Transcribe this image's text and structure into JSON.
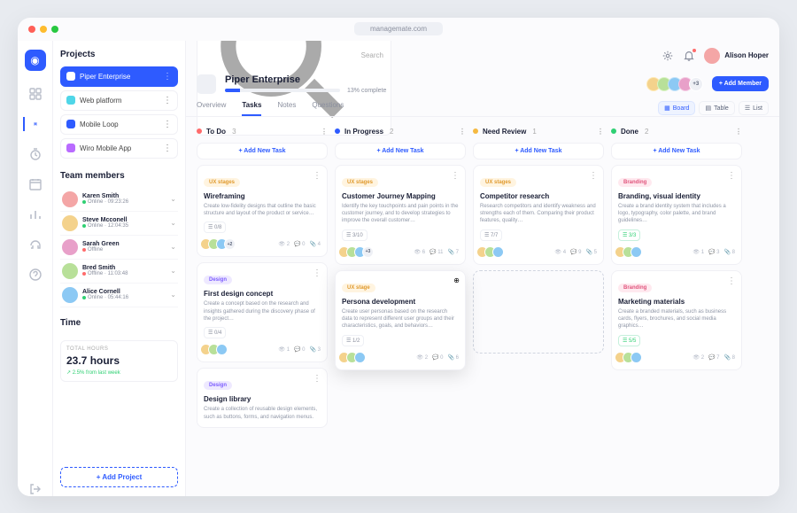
{
  "url": "managemate.com",
  "user": {
    "name": "Alison Hoper"
  },
  "search_placeholder": "Search",
  "sidebar": {
    "projects_title": "Projects",
    "projects": [
      {
        "name": "Piper Enterprise",
        "color": "#fff",
        "active": true
      },
      {
        "name": "Web platform",
        "color": "#4fd6e8"
      },
      {
        "name": "Mobile Loop",
        "color": "#2e5bff"
      },
      {
        "name": "Wiro Mobile App",
        "color": "#b96bff"
      }
    ],
    "members_title": "Team members",
    "members": [
      {
        "name": "Karen Smith",
        "status": "Online",
        "time": "09:23:26",
        "online": true,
        "color": "#f4a6a6"
      },
      {
        "name": "Steve Mcconell",
        "status": "Online",
        "time": "12:04:35",
        "online": true,
        "color": "#f4d28c"
      },
      {
        "name": "Sarah Green",
        "status": "Offline",
        "online": false,
        "color": "#e8a0c9"
      },
      {
        "name": "Bred Smith",
        "status": "Offline",
        "time": "11:03:48",
        "online": false,
        "color": "#b8e099"
      },
      {
        "name": "Alice Cornell",
        "status": "Online",
        "time": "05:44:16",
        "online": true,
        "color": "#8cc9f4"
      }
    ],
    "time_title": "Time",
    "time_label": "TOTAL HOURS",
    "time_value": "23.7 hours",
    "time_delta": "2.5% from last week",
    "add_project": "+ Add Project"
  },
  "project": {
    "title": "Piper Enterprise",
    "progress_pct": 13,
    "progress_text": "13% complete",
    "extra_members": "+3",
    "add_member": "+ Add Member"
  },
  "tabs": [
    "Overview",
    "Tasks",
    "Notes",
    "Questions"
  ],
  "active_tab": "Tasks",
  "views": {
    "board": "Board",
    "table": "Table",
    "list": "List"
  },
  "add_task": "+ Add New Task",
  "columns": [
    {
      "name": "To Do",
      "count": 3,
      "color": "#ff6b6b",
      "cards": [
        {
          "tag": "UX stages",
          "tag_class": "ux",
          "title": "Wireframing",
          "desc": "Create low-fidelity designs that outline the basic structure and layout of the product or service…",
          "chip": "0/8",
          "views": 2,
          "comments": 0,
          "files": 4,
          "extra": "+2"
        },
        {
          "tag": "Design",
          "tag_class": "ds",
          "title": "First design concept",
          "desc": "Create a concept based on the research and insights gathered during the discovery phase of the project…",
          "chip": "0/4",
          "views": 1,
          "comments": 0,
          "files": 3
        },
        {
          "tag": "Design",
          "tag_class": "ds",
          "title": "Design library",
          "desc": "Create a collection of reusable design elements, such as buttons, forms, and navigation menus."
        }
      ]
    },
    {
      "name": "In Progress",
      "count": 2,
      "color": "#2e5bff",
      "cards": [
        {
          "tag": "UX stages",
          "tag_class": "ux",
          "title": "Customer Journey Mapping",
          "desc": "Identify the key touchpoints and pain points in the customer journey, and to develop strategies to improve the overall customer…",
          "chip": "3/10",
          "views": 6,
          "comments": 11,
          "files": 7,
          "extra": "+3"
        },
        {
          "tag": "UX stage",
          "tag_class": "ux",
          "title": "Persona development",
          "desc": "Create user personas based on the research data to represent different user groups and their characteristics, goals, and behaviors…",
          "chip": "1/2",
          "views": 2,
          "comments": 0,
          "files": 6,
          "lifted": true
        }
      ]
    },
    {
      "name": "Need Review",
      "count": 1,
      "color": "#f5b941",
      "cards": [
        {
          "tag": "UX stages",
          "tag_class": "ux",
          "title": "Competitor research",
          "desc": "Research competitors and identify weakness and strengths each of them. Comparing their product features, quality…",
          "chip": "7/7",
          "views": 4,
          "comments": 9,
          "files": 5
        }
      ]
    },
    {
      "name": "Done",
      "count": 2,
      "color": "#2fd073",
      "cards": [
        {
          "tag": "Branding",
          "tag_class": "br",
          "title": "Branding, visual identity",
          "desc": "Create a brand identity system that includes a logo, typography, color palette, and brand guidelines…",
          "chip": "3/3",
          "chip_done": true,
          "views": 1,
          "comments": 3,
          "files": 8
        },
        {
          "tag": "Branding",
          "tag_class": "br",
          "title": "Marketing materials",
          "desc": "Create a branded materials, such as business cards, flyers, brochures, and social media graphics…",
          "chip": "5/5",
          "chip_done": true,
          "views": 2,
          "comments": 7,
          "files": 8
        }
      ]
    }
  ]
}
